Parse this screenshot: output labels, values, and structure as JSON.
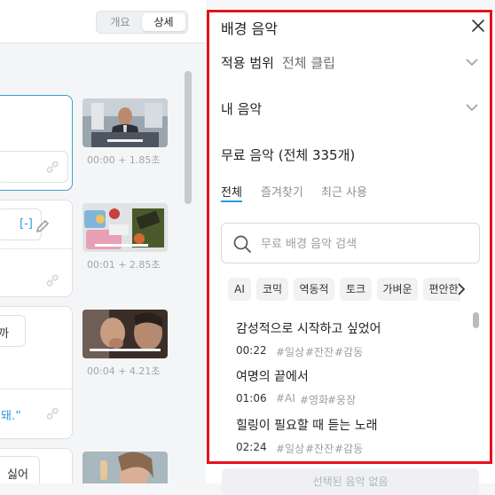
{
  "view_toggle": {
    "summary": "개요",
    "detail": "상세"
  },
  "clips": [
    {
      "time": "00:00 + 1.85초"
    },
    {
      "time": "00:01 + 2.85초",
      "tag": "[-]"
    },
    {
      "time": "00:04 + 4.21초",
      "snippet_top": "까",
      "snippet_bottom": "돼.”"
    },
    {
      "snippet_top": "싫어"
    }
  ],
  "panel": {
    "title": "배경 음악",
    "scope_label": "적용 범위",
    "scope_value": "전체 클립",
    "my_music": "내 음악",
    "free_music": "무료 음악 (전체 335개)",
    "tabs": [
      "전체",
      "즐겨찾기",
      "최근 사용"
    ],
    "search_placeholder": "무료 배경 음악 검색",
    "chips": [
      "AI",
      "코믹",
      "역동적",
      "토크",
      "가벼운",
      "편안한"
    ],
    "tracks": [
      {
        "title": "감성적으로 시작하고 싶었어",
        "duration": "00:22",
        "tags": [
          "#일상",
          "#잔잔",
          "#감동"
        ]
      },
      {
        "title": "여명의 끝에서",
        "duration": "01:06",
        "tags": [
          "#AI",
          "#영화",
          "#웅장"
        ]
      },
      {
        "title": "힐링이 필요할 때 듣는 노래",
        "duration": "02:24",
        "tags": [
          "#일상",
          "#잔잔",
          "#감동"
        ]
      }
    ],
    "bottom_button": "선택된 음악 없음"
  },
  "colors": {
    "highlight_frame": "#e6121a",
    "accent": "#2a9fd6"
  }
}
